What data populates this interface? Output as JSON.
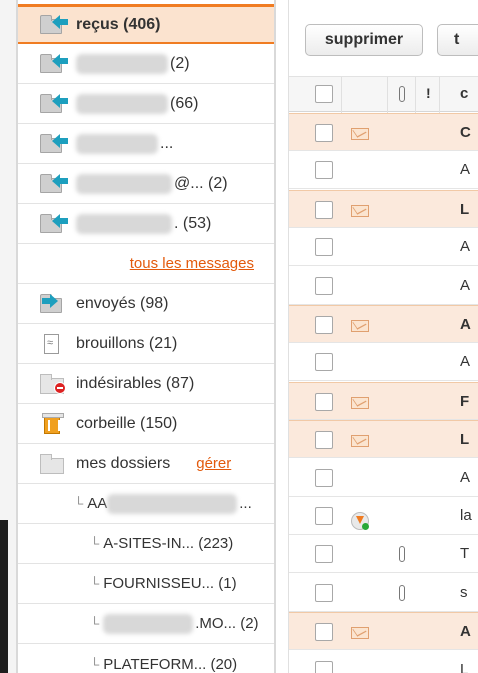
{
  "folders": {
    "inbox": {
      "label": "reçus",
      "count": "(406)"
    },
    "accounts": [
      {
        "suffix": "(2)"
      },
      {
        "suffix": "(66)"
      },
      {
        "suffix": "..."
      },
      {
        "suffix": "@... (2)"
      },
      {
        "suffix": ". (53)"
      }
    ],
    "all_messages_link": "tous les messages",
    "sent": "envoyés (98)",
    "drafts": "brouillons (21)",
    "spam": "indésirables (87)",
    "trash": "corbeille (150)",
    "my_folders": "mes dossiers",
    "manage_link": "gérer",
    "subfolders": [
      {
        "prefix": "AA",
        "suffix": "..."
      },
      {
        "label": "A-SITES-IN... (223)"
      },
      {
        "label": "FOURNISSEU... (1)"
      },
      {
        "prefix": "",
        "suffix": ".MO... (2)"
      },
      {
        "label": "PLATEFORM... (20)"
      }
    ]
  },
  "toolbar": {
    "delete_label": "supprimer",
    "second_label": "t"
  },
  "list_header": {
    "exclamation": "!",
    "col_initial": "c"
  },
  "messages": [
    {
      "unread": true,
      "initial": "C"
    },
    {
      "unread": false,
      "initial": "A"
    },
    {
      "unread": true,
      "initial": "L"
    },
    {
      "unread": false,
      "initial": "A"
    },
    {
      "unread": false,
      "initial": "A"
    },
    {
      "unread": true,
      "initial": "A"
    },
    {
      "unread": false,
      "initial": "A"
    },
    {
      "unread": true,
      "initial": "F"
    },
    {
      "unread": true,
      "initial": "L"
    },
    {
      "unread": false,
      "initial": "A"
    },
    {
      "unread": false,
      "initial": "la"
    },
    {
      "unread": false,
      "initial": "T"
    },
    {
      "unread": false,
      "initial": "s"
    },
    {
      "unread": true,
      "initial": "A"
    },
    {
      "unread": false,
      "initial": "L"
    }
  ],
  "colors": {
    "accent": "#f07c22",
    "link": "#e35a0c",
    "selected_bg": "#fbe3cf",
    "unread_bg": "#fbe9dc",
    "arrow": "#1d9fbe"
  }
}
